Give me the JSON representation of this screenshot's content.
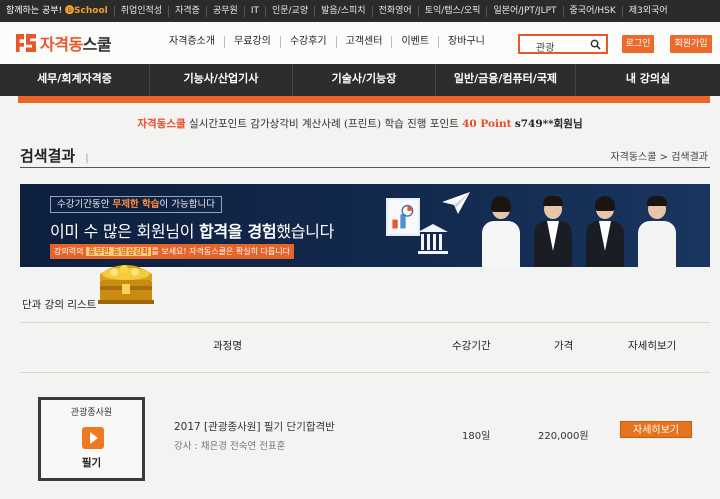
{
  "topbar": {
    "first_text": "함께하는 공부!",
    "first_accent": "🅑School",
    "items": [
      "취업인적성",
      "자격증",
      "공무원",
      "IT",
      "인문/교양",
      "발음/스피치",
      "전화영어",
      "토익/텝스/오픽",
      "일본어/JPT/JLPT",
      "중국어/HSK",
      "제3외국어"
    ]
  },
  "header": {
    "logo_brand": "자격동",
    "logo_suffix": "스쿨",
    "gnb": [
      "자격증소개",
      "무료강의",
      "수강후기",
      "고객센터",
      "이벤트",
      "장바구니"
    ],
    "search_value": "관광",
    "login_label": "로그인",
    "join_label": "회원가입"
  },
  "mainnav": [
    "세무/회계자격증",
    "기능사/산업기사",
    "기술사/기능장",
    "일반/금융/컴퓨터/국제",
    "내 강의실"
  ],
  "points": {
    "brand": "자격동스쿨",
    "text": "실시간포인트 감가상각비 계산사례 (프린트) 학습 진행 포인트",
    "value": "40 Point",
    "user": "s749**회원님"
  },
  "results": {
    "title": "검색결과",
    "bar": "|",
    "breadcrumb": "자격동스쿨 > 검색결과"
  },
  "banner": {
    "top_pre": "수강기간동안",
    "top_hl": "무제한 학습",
    "top_post": "이 가능합니다",
    "main_pre": "이미 수 많은 회원님이",
    "main_b1": "합격을 경험",
    "main_post": "했습니다",
    "sub_pre": "강의력의",
    "sub_tag": "풍부한 동영상강좌",
    "sub_post": "를 보세요! 자격동스쿨은 확실히 다릅니다"
  },
  "list": {
    "title": "단과 강의 리스트",
    "headers": {
      "course": "과정명",
      "period": "수강기간",
      "price": "가격",
      "detail": "자세히보기"
    },
    "rows": [
      {
        "category": "관광종사원",
        "kind": "필기",
        "name": "2017 [관광종사원] 필기 단기합격반",
        "teacher": "강사 : 채은경 전숙연 전표훈",
        "period": "180일",
        "price": "220,000원",
        "detail_label": "자세히보기"
      }
    ]
  },
  "colors": {
    "accent": "#ea6527",
    "dark_nav": "#2d2d2d",
    "banner_bg": "#12294d"
  },
  "icons": [
    "search-icon",
    "play-icon",
    "chart-icon",
    "bank-icon",
    "paper-plane-icon",
    "treasure-chest-icon",
    "logo-icon"
  ]
}
